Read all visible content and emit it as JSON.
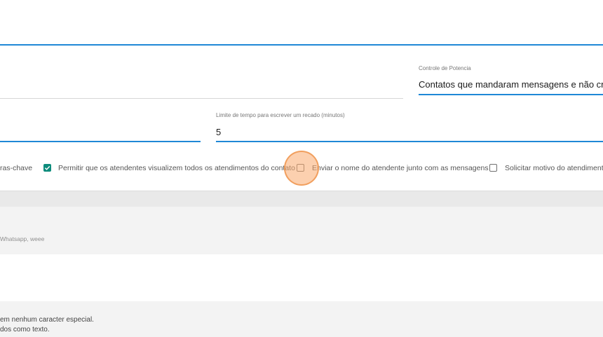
{
  "power_control": {
    "label": "Controle de Potencia",
    "value": "Contatos que mandaram mensagens e não cri"
  },
  "time_limit": {
    "label": "Limite de tempo para escrever um recado (minutos)",
    "value": "5"
  },
  "checkboxes": [
    {
      "label": "ras-chave"
    },
    {
      "label": "Permitir que os atendentes visualizem todos os atendimentos do contato",
      "checked": true
    },
    {
      "label": "Enviar o nome do atendente junto com as mensagens",
      "checked": false
    },
    {
      "label": "Solicitar motivo do atendimento",
      "checked": false
    }
  ],
  "channel_hint": "Whatsapp, weee",
  "notes": [
    "em nenhum caracter especial.",
    "dos como texto."
  ],
  "colors": {
    "accent_blue": "#1f88d6",
    "check_teal": "#0e8c7c",
    "cursor_orange": "#f39a55"
  }
}
